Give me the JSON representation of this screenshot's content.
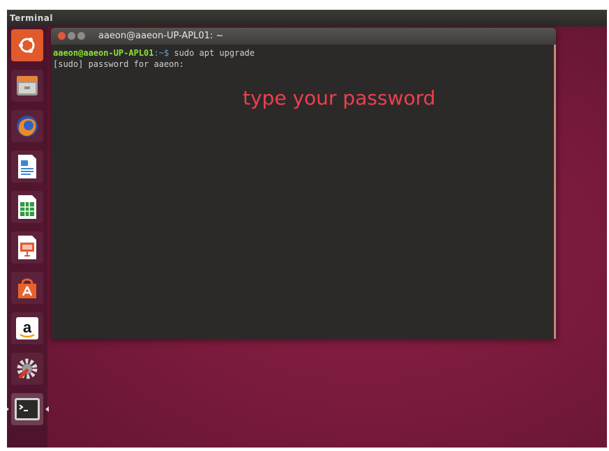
{
  "panel": {
    "app_name": "Terminal"
  },
  "launcher": {
    "items": [
      {
        "name": "dash-home-icon"
      },
      {
        "name": "files-icon"
      },
      {
        "name": "firefox-icon"
      },
      {
        "name": "libreoffice-writer-icon"
      },
      {
        "name": "libreoffice-calc-icon"
      },
      {
        "name": "libreoffice-impress-icon"
      },
      {
        "name": "ubuntu-software-icon"
      },
      {
        "name": "amazon-icon"
      },
      {
        "name": "system-settings-icon"
      },
      {
        "name": "terminal-icon"
      }
    ]
  },
  "terminal": {
    "title": "aaeon@aaeon-UP-APL01: ~",
    "prompt_user": "aaeon@aaeon-UP-APL01",
    "prompt_path": ":~$",
    "command": " sudo apt upgrade",
    "line2": "[sudo] password for aaeon:"
  },
  "annotation": {
    "text": "type your password",
    "color": "#ec3f4f"
  }
}
